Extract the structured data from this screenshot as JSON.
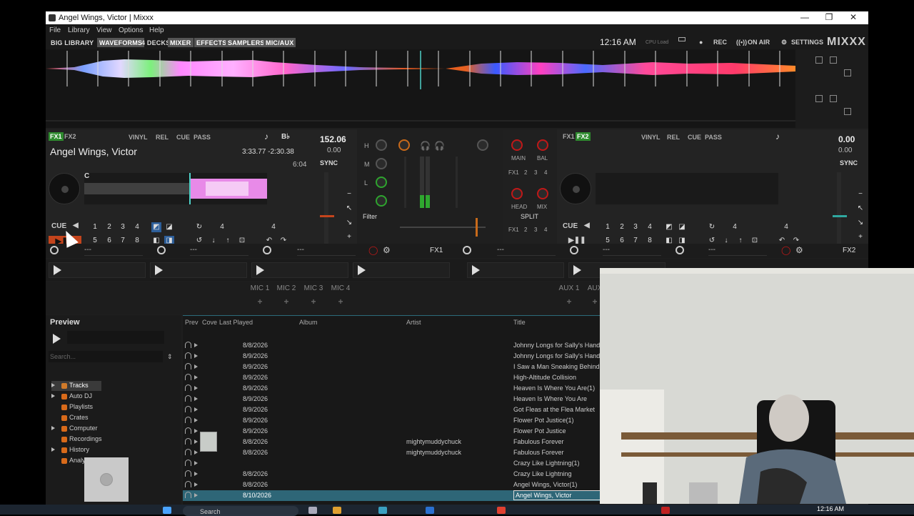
{
  "window": {
    "title": "Angel Wings, Victor | Mixxx",
    "controls": [
      "—",
      "❐",
      "✕"
    ]
  },
  "menu": [
    "File",
    "Library",
    "View",
    "Options",
    "Help"
  ],
  "toolbar": {
    "buttons": [
      {
        "label": "BIG LIBRARY",
        "active": false
      },
      {
        "label": "WAVEFORMS",
        "active": true
      },
      {
        "label": "4 DECKS",
        "active": false
      },
      {
        "label": "MIXER",
        "active": true
      },
      {
        "label": "EFFECTS",
        "active": true
      },
      {
        "label": "SAMPLERS",
        "active": true
      },
      {
        "label": "MIC/AUX",
        "active": true
      }
    ],
    "clock": "12:16 AM",
    "cpu": "CPU Load",
    "rec": "REC",
    "on_air": "ON AIR",
    "settings": "SETTINGS",
    "logo": "MIXXX"
  },
  "deck1": {
    "fx1": "FX1",
    "fx2": "FX2",
    "vinyl": "VINYL",
    "rel": "REL",
    "cue": "CUE",
    "pass": "PASS",
    "key": "B♭",
    "bpm": "152.06",
    "bpm_adjust": "0.00",
    "title": "Angel Wings, Victor",
    "time": "3:33.77 -2:30.38",
    "duration": "6:04",
    "sync": "SYNC",
    "cue_label": "CUE",
    "hotcue_marker": "C",
    "pads": [
      "1",
      "2",
      "3",
      "4",
      "5",
      "6",
      "7",
      "8"
    ],
    "beatjump": "4",
    "loop": "4"
  },
  "deck2": {
    "fx1": "FX1",
    "fx2": "FX2",
    "vinyl": "VINYL",
    "rel": "REL",
    "cue": "CUE",
    "pass": "PASS",
    "bpm": "0.00",
    "bpm_adjust": "0.00",
    "sync": "SYNC",
    "cue_label": "CUE",
    "pads": [
      "1",
      "2",
      "3",
      "4",
      "5",
      "6",
      "7",
      "8"
    ],
    "beatjump": "4",
    "loop": "4"
  },
  "mixer": {
    "eq": [
      "H",
      "M",
      "L"
    ],
    "filter": "Filter",
    "main": "MAIN",
    "bal": "BAL",
    "head": "HEAD",
    "mix": "MIX",
    "split": "SPLIT",
    "fx_assign": [
      "FX1",
      "2",
      "3",
      "4"
    ],
    "deck1_level": 0.25
  },
  "effects": {
    "slot_value": "---",
    "unit1": "FX1",
    "unit2": "FX2"
  },
  "mics": [
    "MIC 1",
    "MIC 2",
    "MIC 3",
    "MIC 4"
  ],
  "aux": [
    "AUX 1",
    "AUX"
  ],
  "mic_add": "+",
  "preview": {
    "label": "Preview",
    "search_placeholder": "Search..."
  },
  "tree": [
    {
      "label": "Tracks",
      "color": "#d07a2a",
      "expand": true,
      "selected": true
    },
    {
      "label": "Auto DJ",
      "color": "#d86a1a",
      "expand": true,
      "selected": false
    },
    {
      "label": "Playlists",
      "color": "#d86a1a",
      "expand": false,
      "selected": false
    },
    {
      "label": "Crates",
      "color": "#d86a1a",
      "expand": false,
      "selected": false
    },
    {
      "label": "Computer",
      "color": "#d86a1a",
      "expand": true,
      "selected": false
    },
    {
      "label": "Recordings",
      "color": "#d86a1a",
      "expand": false,
      "selected": false
    },
    {
      "label": "History",
      "color": "#d86a1a",
      "expand": true,
      "selected": false
    },
    {
      "label": "Analyze",
      "color": "#d86a1a",
      "expand": false,
      "selected": false
    }
  ],
  "library": {
    "columns": [
      "Prev",
      "Cove",
      "Last Played",
      "Album",
      "Artist",
      "Title"
    ],
    "rows": [
      {
        "last_played": "8/8/2026",
        "artist": "",
        "title": "Johnny Longs for Sally's Hand(",
        "thumb": false
      },
      {
        "last_played": "8/9/2026",
        "artist": "",
        "title": "Johnny Longs for Sally's Hand",
        "thumb": false
      },
      {
        "last_played": "8/9/2026",
        "artist": "",
        "title": "I Saw a Man Sneaking Behind",
        "thumb": false
      },
      {
        "last_played": "8/9/2026",
        "artist": "",
        "title": "High-Altitude Collision",
        "thumb": false
      },
      {
        "last_played": "8/9/2026",
        "artist": "",
        "title": "Heaven Is Where You Are(1)",
        "thumb": false
      },
      {
        "last_played": "8/9/2026",
        "artist": "",
        "title": "Heaven Is Where You Are",
        "thumb": false
      },
      {
        "last_played": "8/9/2026",
        "artist": "",
        "title": "Got Fleas at the Flea Market",
        "thumb": false
      },
      {
        "last_played": "8/9/2026",
        "artist": "",
        "title": "Flower Pot Justice(1)",
        "thumb": false
      },
      {
        "last_played": "8/9/2026",
        "artist": "",
        "title": "Flower Pot Justice",
        "thumb": false
      },
      {
        "last_played": "8/8/2026",
        "artist": "mightymuddychuck",
        "title": "Fabulous Forever",
        "thumb": true
      },
      {
        "last_played": "8/8/2026",
        "artist": "mightymuddychuck",
        "title": "Fabulous Forever",
        "thumb": false
      },
      {
        "last_played": "",
        "artist": "",
        "title": "Crazy Like Lightning(1)",
        "thumb": false
      },
      {
        "last_played": "8/8/2026",
        "artist": "",
        "title": "Crazy Like Lightning",
        "thumb": false
      },
      {
        "last_played": "8/8/2026",
        "artist": "",
        "title": "Angel Wings, Victor(1)",
        "thumb": false
      },
      {
        "last_played": "8/10/2026",
        "artist": "",
        "title": "Angel Wings, Victor",
        "thumb": false,
        "current": true
      }
    ]
  },
  "taskbar": {
    "search": "Search",
    "time": "12:16 AM"
  }
}
